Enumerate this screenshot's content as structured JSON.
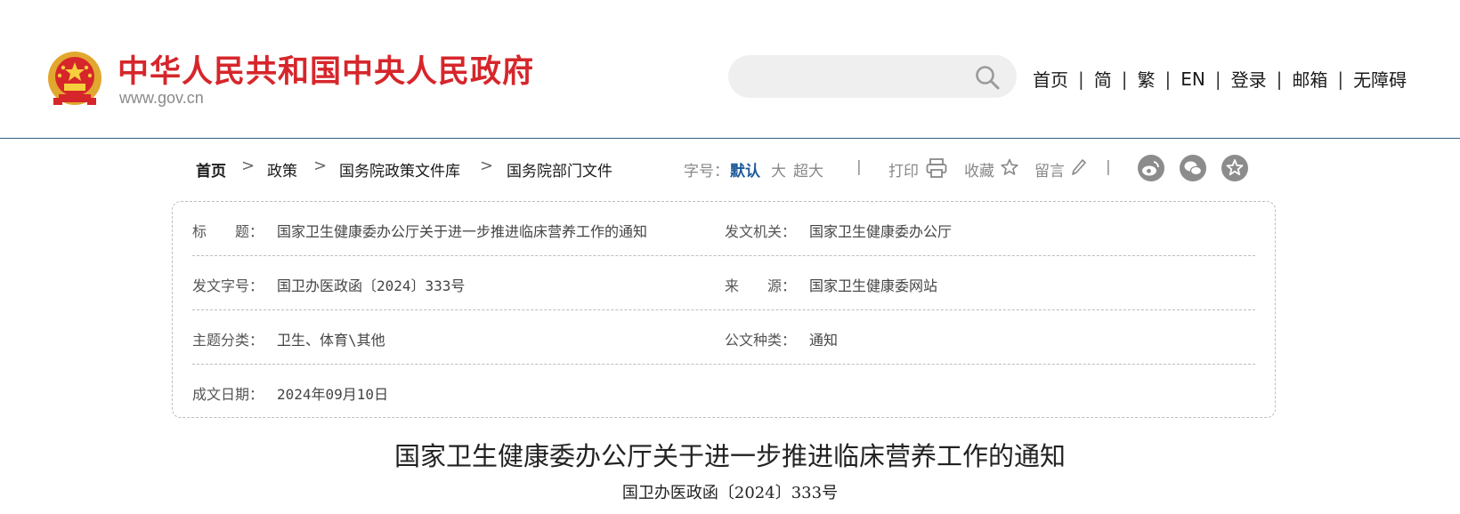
{
  "header": {
    "site_title": "中华人民共和国中央人民政府",
    "site_url": "www.gov.cn",
    "search": {
      "value": "",
      "placeholder": ""
    },
    "nav": [
      "首页",
      "简",
      "繁",
      "EN",
      "登录",
      "邮箱",
      "无障碍"
    ],
    "nav_separator": "|"
  },
  "breadcrumb": {
    "items": [
      "首页",
      "政策",
      "国务院政策文件库",
      "国务院部门文件"
    ],
    "separator": ">"
  },
  "toolbar": {
    "font_size_label": "字号：",
    "font_sizes": [
      "默认",
      "大",
      "超大"
    ],
    "active_font_size": "默认",
    "separator": "|",
    "print_label": "打印",
    "favorite_label": "收藏",
    "comment_label": "留言"
  },
  "icons": [
    "emblem-icon",
    "search-icon",
    "printer-icon",
    "star-icon",
    "pencil-icon",
    "weibo-icon",
    "wechat-icon",
    "favorite-share-icon"
  ],
  "info": {
    "rows": [
      {
        "left_label": "标　　题：",
        "left_value": "国家卫生健康委办公厅关于进一步推进临床营养工作的通知",
        "right_label": "发文机关：",
        "right_value": "国家卫生健康委办公厅"
      },
      {
        "left_label": "发文字号：",
        "left_value": "国卫办医政函〔2024〕333号",
        "right_label": "来　　源：",
        "right_value": "国家卫生健康委网站"
      },
      {
        "left_label": "主题分类：",
        "left_value": "卫生、体育\\其他",
        "right_label": "公文种类：",
        "right_value": "通知"
      },
      {
        "left_label": "成文日期：",
        "left_value": "2024年09月10日"
      }
    ]
  },
  "article": {
    "title": "国家卫生健康委办公厅关于进一步推进临床营养工作的通知",
    "doc_number": "国卫办医政函〔2024〕333号"
  },
  "colors": {
    "brand_red": "#d6262b",
    "active_blue": "#1d5a99",
    "header_rule": "#2f5f86",
    "share_icon_gray": "#8c8c8c"
  }
}
